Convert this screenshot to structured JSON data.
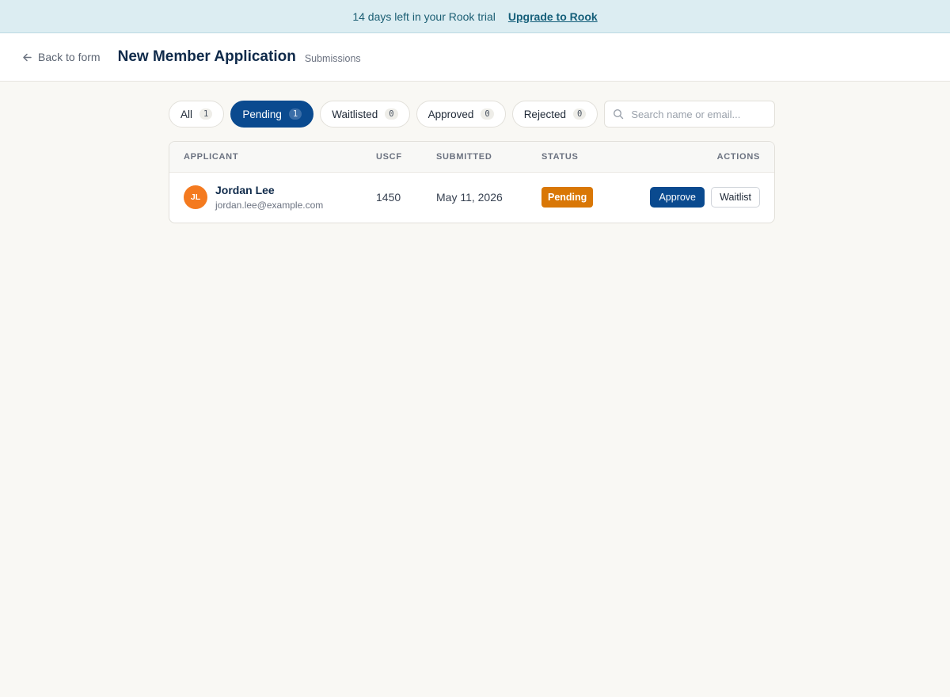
{
  "banner": {
    "message": "14 days left in your Rook trial",
    "upgrade_label": "Upgrade to Rook"
  },
  "header": {
    "back_label": "Back to form",
    "title": "New Member Application",
    "subtitle": "Submissions"
  },
  "filters": [
    {
      "label": "All",
      "count": "1",
      "active": false
    },
    {
      "label": "Pending",
      "count": "1",
      "active": true
    },
    {
      "label": "Waitlisted",
      "count": "0",
      "active": false
    },
    {
      "label": "Approved",
      "count": "0",
      "active": false
    },
    {
      "label": "Rejected",
      "count": "0",
      "active": false
    }
  ],
  "search": {
    "placeholder": "Search name or email...",
    "value": ""
  },
  "table": {
    "columns": {
      "applicant": "APPLICANT",
      "uscf": "USCF",
      "submitted": "SUBMITTED",
      "status": "STATUS",
      "actions": "ACTIONS"
    },
    "rows": [
      {
        "initials": "JL",
        "name": "Jordan Lee",
        "email": "jordan.lee@example.com",
        "uscf": "1450",
        "submitted": "May 11, 2026",
        "status": "Pending",
        "approve_label": "Approve",
        "waitlist_label": "Waitlist"
      }
    ]
  },
  "colors": {
    "primary": "#0a4a8f",
    "pending": "#d97706",
    "avatar": "#f47a1f",
    "banner_bg": "#dcedf2"
  }
}
